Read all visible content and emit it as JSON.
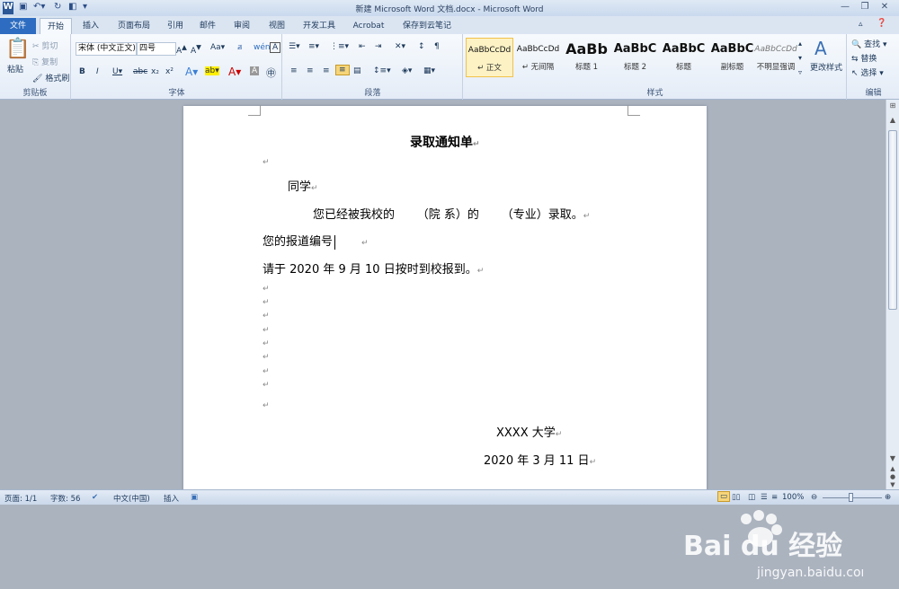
{
  "window": {
    "title": "新建 Microsoft Word 文档.docx - Microsoft Word"
  },
  "tabs": [
    "文件",
    "开始",
    "插入",
    "页面布局",
    "引用",
    "邮件",
    "审阅",
    "视图",
    "开发工具",
    "Acrobat",
    "保存到云笔记"
  ],
  "clipboard": {
    "paste": "粘贴",
    "cut": "剪切",
    "copy": "复制",
    "format_painter": "格式刷",
    "label": "剪贴板"
  },
  "font": {
    "name": "宋体 (中文正文)",
    "size": "四号",
    "label": "字体"
  },
  "paragraph": {
    "label": "段落"
  },
  "styles": {
    "label": "样式",
    "items": [
      {
        "preview": "AaBbCcDd",
        "name": "↵ 正文"
      },
      {
        "preview": "AaBbCcDd",
        "name": "↵ 无间隔"
      },
      {
        "preview": "AaBb",
        "name": "标题 1"
      },
      {
        "preview": "AaBbC",
        "name": "标题 2"
      },
      {
        "preview": "AaBbC",
        "name": "标题"
      },
      {
        "preview": "AaBbC",
        "name": "副标题"
      },
      {
        "preview": "AaBbCcDd",
        "name": "不明显强调"
      }
    ],
    "change": "更改样式"
  },
  "editing": {
    "find": "查找 ▾",
    "replace": "替换",
    "select": "选择 ▾",
    "label": "编辑"
  },
  "document": {
    "title": "录取通知单",
    "salutation": "同学",
    "body1": "您已经被我校的      （院 系）的      （专业）录取。",
    "body2": "您的报道编号",
    "body3": "请于 2020 年 9 月 10 日按时到校报到。",
    "signature": "XXXX 大学",
    "date": "2020 年 3 月 11 日",
    "para_mark": "↵"
  },
  "status": {
    "page": "页面: 1/1",
    "words": "字数: 56",
    "lang": "中文(中国)",
    "mode": "插入",
    "zoom": "100%"
  },
  "watermark": {
    "brand": "Bai du 经验",
    "url": "jingyan.baidu.com"
  },
  "colors": {
    "file_tab": "#2d6cc0",
    "ribbon_bg": "#e4ecf7",
    "workspace": "#abb3bf"
  }
}
